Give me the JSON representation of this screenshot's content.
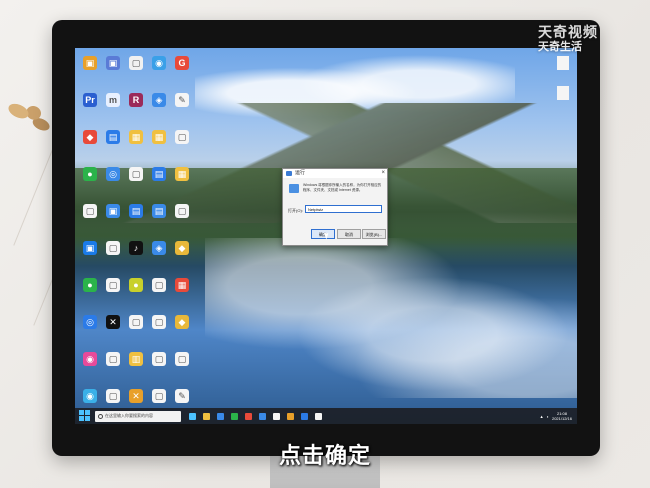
{
  "watermark": {
    "main": "天奇视频",
    "sub": "天奇生活"
  },
  "caption": "点击确定",
  "desktop": {
    "icons": [
      {
        "name": "app-icon",
        "label": "",
        "color": "#e8a02a",
        "glyph": "▣"
      },
      {
        "name": "app-icon",
        "label": "",
        "color": "#5a7bd6",
        "glyph": "▣"
      },
      {
        "name": "app-icon",
        "label": "",
        "color": "#f1f1f1",
        "glyph": "▢"
      },
      {
        "name": "app-icon",
        "label": "",
        "color": "#3aa0e8",
        "glyph": "◉"
      },
      {
        "name": "app-icon",
        "label": "",
        "color": "#e84a3a",
        "glyph": "G"
      },
      {
        "name": "app-icon",
        "label": "",
        "color": "#2b5fd0",
        "glyph": "Pr"
      },
      {
        "name": "app-icon",
        "label": "",
        "color": "#e8f0ff",
        "glyph": "m"
      },
      {
        "name": "app-icon",
        "label": "",
        "color": "#9b2b5a",
        "glyph": "R"
      },
      {
        "name": "app-icon",
        "label": "",
        "color": "#3a8ae8",
        "glyph": "◈"
      },
      {
        "name": "app-icon",
        "label": "",
        "color": "#f5f5f5",
        "glyph": "✎"
      },
      {
        "name": "app-icon",
        "label": "",
        "color": "#e84a3a",
        "glyph": "◆"
      },
      {
        "name": "app-icon",
        "label": "",
        "color": "#2b7be8",
        "glyph": "▤"
      },
      {
        "name": "app-icon",
        "label": "",
        "color": "#f0c040",
        "glyph": "▦"
      },
      {
        "name": "app-icon",
        "label": "",
        "color": "#f0c040",
        "glyph": "▦"
      },
      {
        "name": "app-icon",
        "label": "",
        "color": "#f5f5f5",
        "glyph": "▢"
      },
      {
        "name": "app-icon",
        "label": "",
        "color": "#2bb34a",
        "glyph": "●"
      },
      {
        "name": "app-icon",
        "label": "",
        "color": "#3a8ae8",
        "glyph": "◎"
      },
      {
        "name": "app-icon",
        "label": "",
        "color": "#f5f5f5",
        "glyph": "▢"
      },
      {
        "name": "app-icon",
        "label": "",
        "color": "#2b7be8",
        "glyph": "▤"
      },
      {
        "name": "app-icon",
        "label": "",
        "color": "#f0c040",
        "glyph": "▦"
      },
      {
        "name": "app-icon",
        "label": "",
        "color": "#f5f5f5",
        "glyph": "▢"
      },
      {
        "name": "app-icon",
        "label": "",
        "color": "#3a8ae8",
        "glyph": "▣"
      },
      {
        "name": "app-icon",
        "label": "",
        "color": "#2b7be8",
        "glyph": "▤"
      },
      {
        "name": "app-icon",
        "label": "",
        "color": "#3a8ae8",
        "glyph": "▤"
      },
      {
        "name": "app-icon",
        "label": "",
        "color": "#f5f5f5",
        "glyph": "▢"
      },
      {
        "name": "app-icon",
        "label": "",
        "color": "#1a7be8",
        "glyph": "▣"
      },
      {
        "name": "app-icon",
        "label": "",
        "color": "#f5f5f5",
        "glyph": "▢"
      },
      {
        "name": "app-icon",
        "label": "",
        "color": "#111111",
        "glyph": "♪"
      },
      {
        "name": "app-icon",
        "label": "",
        "color": "#3a8ae8",
        "glyph": "◈"
      },
      {
        "name": "app-icon",
        "label": "",
        "color": "#e8b83a",
        "glyph": "◆"
      },
      {
        "name": "app-icon",
        "label": "",
        "color": "#2bb34a",
        "glyph": "●"
      },
      {
        "name": "app-icon",
        "label": "",
        "color": "#f5f5f5",
        "glyph": "▢"
      },
      {
        "name": "app-icon",
        "label": "",
        "color": "#c8d02b",
        "glyph": "●"
      },
      {
        "name": "app-icon",
        "label": "",
        "color": "#f5f5f5",
        "glyph": "▢"
      },
      {
        "name": "app-icon",
        "label": "",
        "color": "#e84a3a",
        "glyph": "▦"
      },
      {
        "name": "app-icon",
        "label": "",
        "color": "#2b7be8",
        "glyph": "◎"
      },
      {
        "name": "app-icon",
        "label": "",
        "color": "#111111",
        "glyph": "✕"
      },
      {
        "name": "app-icon",
        "label": "",
        "color": "#f5f5f5",
        "glyph": "▢"
      },
      {
        "name": "app-icon",
        "label": "",
        "color": "#f5f5f5",
        "glyph": "▢"
      },
      {
        "name": "app-icon",
        "label": "",
        "color": "#e8b83a",
        "glyph": "◆"
      },
      {
        "name": "app-icon",
        "label": "",
        "color": "#e84a9a",
        "glyph": "◉"
      },
      {
        "name": "app-icon",
        "label": "",
        "color": "#f5f5f5",
        "glyph": "▢"
      },
      {
        "name": "app-icon",
        "label": "",
        "color": "#f0c040",
        "glyph": "▥"
      },
      {
        "name": "app-icon",
        "label": "",
        "color": "#f5f5f5",
        "glyph": "▢"
      },
      {
        "name": "app-icon",
        "label": "",
        "color": "#f5f5f5",
        "glyph": "▢"
      },
      {
        "name": "app-icon",
        "label": "",
        "color": "#3ab0e8",
        "glyph": "◉"
      },
      {
        "name": "app-icon",
        "label": "",
        "color": "#f5f5f5",
        "glyph": "▢"
      },
      {
        "name": "app-icon",
        "label": "",
        "color": "#e8a02a",
        "glyph": "✕"
      },
      {
        "name": "app-icon",
        "label": "",
        "color": "#f5f5f5",
        "glyph": "▢"
      },
      {
        "name": "app-icon",
        "label": "",
        "color": "#f5f5f5",
        "glyph": "✎"
      }
    ]
  },
  "run_dialog": {
    "title": "运行",
    "description": "Windows 将根据你所输入的名称，为你打开相应的程序、文件夹、文档或 Internet 资源。",
    "open_label": "打开(O):",
    "input_value": "Netplwiz",
    "ok_label": "确定",
    "cancel_label": "取消",
    "browse_label": "浏览(B)..."
  },
  "taskbar": {
    "search_placeholder": "在这里输入你要搜索的内容",
    "clock_time": "21:08",
    "clock_date": "2021/12/16",
    "app_colors": [
      "#4cc2ff",
      "#f0c040",
      "#3a8ae8",
      "#2bb34a",
      "#e84a3a",
      "#3a8ae8",
      "#f5f5f5",
      "#e8a02a",
      "#2b7be8",
      "#f5f5f5"
    ]
  }
}
